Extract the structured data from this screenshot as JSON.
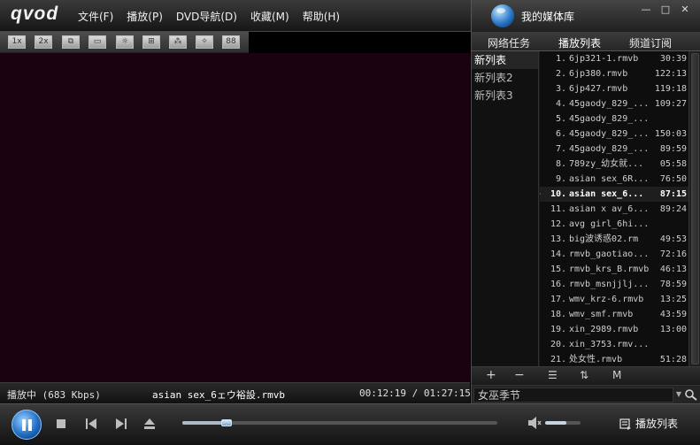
{
  "app": {
    "logo_text": "qvod",
    "library_label": "我的媒体库",
    "window_buttons": [
      "—",
      "□",
      "✕"
    ]
  },
  "menu": [
    "文件(F)",
    "播放(P)",
    "DVD导航(D)",
    "收藏(M)",
    "帮助(H)"
  ],
  "toolbar": [
    "1x",
    "2x",
    "⧉",
    "▭",
    "☼",
    "⊞",
    "⁂",
    "✧",
    "88"
  ],
  "status": {
    "state": "播放中 (683 Kbps)",
    "file": "asian sex_6ェウ裕設.rmvb",
    "time": "00:12:19 / 01:27:15"
  },
  "panel": {
    "tabs": [
      "网络任务",
      "播放列表",
      "频道订阅"
    ],
    "active_tab": 1,
    "lists": [
      "新列表",
      "新列表2",
      "新列表3"
    ],
    "active_list": 0,
    "current_track": 9,
    "tracks": [
      {
        "num": "1.",
        "name": "6jp321-1.rmvb",
        "dur": "30:39"
      },
      {
        "num": "2.",
        "name": "6jp380.rmvb",
        "dur": "122:13"
      },
      {
        "num": "3.",
        "name": "6jp427.rmvb",
        "dur": "119:18"
      },
      {
        "num": "4.",
        "name": "45gaody_829_...",
        "dur": "109:27"
      },
      {
        "num": "5.",
        "name": "45gaody_829_...",
        "dur": ""
      },
      {
        "num": "6.",
        "name": "45gaody_829_...",
        "dur": "150:03"
      },
      {
        "num": "7.",
        "name": "45gaody_829_...",
        "dur": "89:59"
      },
      {
        "num": "8.",
        "name": "789zy_幼女就...",
        "dur": "05:58"
      },
      {
        "num": "9.",
        "name": "asian sex_6R...",
        "dur": "76:50"
      },
      {
        "num": "10.",
        "name": "asian sex_6...",
        "dur": "87:15"
      },
      {
        "num": "11.",
        "name": "asian x av_6...",
        "dur": "89:24"
      },
      {
        "num": "12.",
        "name": "avg girl_6hi...",
        "dur": ""
      },
      {
        "num": "13.",
        "name": "big波诱惑02.rm",
        "dur": "49:53"
      },
      {
        "num": "14.",
        "name": "rmvb_gaotiao...",
        "dur": "72:16"
      },
      {
        "num": "15.",
        "name": "rmvb_krs_B.rmvb",
        "dur": "46:13"
      },
      {
        "num": "16.",
        "name": "rmvb_msnjjlj...",
        "dur": "78:59"
      },
      {
        "num": "17.",
        "name": "wmv_krz-6.rmvb",
        "dur": "13:25"
      },
      {
        "num": "18.",
        "name": "wmv_smf.rmvb",
        "dur": "43:59"
      },
      {
        "num": "19.",
        "name": "xin_2989.rmvb",
        "dur": "13:00"
      },
      {
        "num": "20.",
        "name": "xin_3753.rmv...",
        "dur": ""
      },
      {
        "num": "21.",
        "name": "处女性.rmvb",
        "dur": "51:28"
      }
    ],
    "list_controls": [
      "+",
      "−",
      "☰",
      "⇅",
      "M"
    ],
    "search_value": "女巫季节"
  },
  "player": {
    "progress": 0.141,
    "volume": 0.6,
    "playlist_label": "播放列表"
  }
}
